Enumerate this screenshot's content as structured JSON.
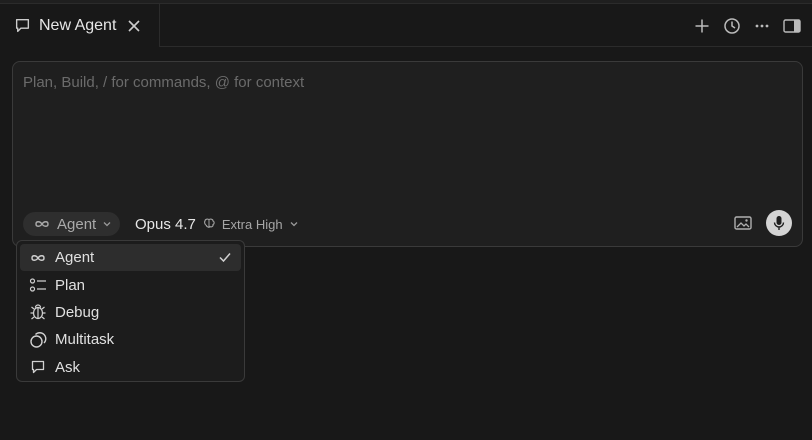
{
  "tab": {
    "title": "New Agent"
  },
  "composer": {
    "placeholder": "Plan, Build, / for commands, @ for context",
    "mode_label": "Agent",
    "model_name": "Opus 4.7",
    "effort_label": "Extra High"
  },
  "menu": {
    "items": [
      {
        "label": "Agent",
        "icon": "infinity-icon",
        "selected": true
      },
      {
        "label": "Plan",
        "icon": "checklist-icon",
        "selected": false
      },
      {
        "label": "Debug",
        "icon": "bug-icon",
        "selected": false
      },
      {
        "label": "Multitask",
        "icon": "multitask-icon",
        "selected": false
      },
      {
        "label": "Ask",
        "icon": "chat-bubble-icon",
        "selected": false
      }
    ]
  }
}
